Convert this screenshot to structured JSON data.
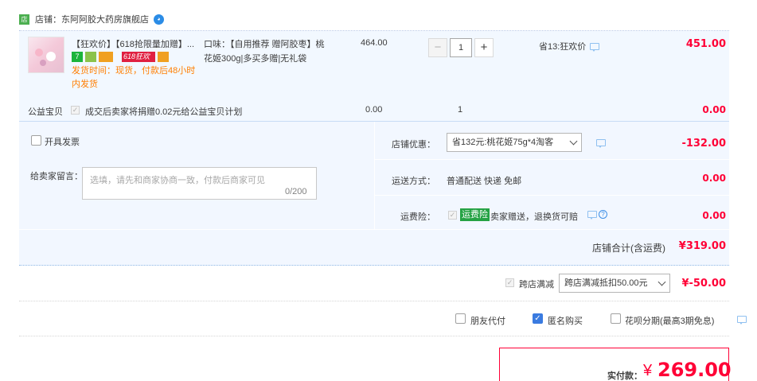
{
  "shop": {
    "icon": "店",
    "label": "店铺：东阿阿胶大药房旗舰店"
  },
  "item": {
    "title": "【狂欢价】【618抢限量加赠】...",
    "badge_618": "618狂欢",
    "badge_7": "7",
    "ship": "发货时间：现货，付款后48小时内发货",
    "sku": "口味：【自用推荐 赠阿胶枣】桃花姬300g|多买多赠|无礼袋",
    "price": "464.00",
    "qty": "1",
    "minus": "−",
    "plus": "+",
    "save": "省13:狂欢价",
    "total": "451.00"
  },
  "charity": {
    "label": "公益宝贝",
    "text": "成交后卖家将捐赠0.02元给公益宝贝计划",
    "price": "0.00",
    "qty": "1",
    "total": "0.00"
  },
  "invoice": {
    "label": "开具发票"
  },
  "message": {
    "label": "给卖家留言：",
    "placeholder": "选填，请先和商家协商一致，付款后商家可见",
    "count": "0/200"
  },
  "coupon": {
    "label": "店铺优惠：",
    "selected": "省132元:桃花姬75g*4淘客",
    "value": "-132.00"
  },
  "shipping": {
    "label": "运送方式：",
    "value": "普通配送 快递 免邮",
    "price": "0.00"
  },
  "insurance": {
    "label": "运费险：",
    "badge": "运费险",
    "text": "卖家赠送，退换货可赔",
    "price": "0.00"
  },
  "shop_total": {
    "label": "店铺合计(含运费)",
    "value": "¥319.00"
  },
  "cross_store": {
    "label": "跨店满减",
    "selected": "跨店满减抵扣50.00元",
    "value": "¥-50.00"
  },
  "options": {
    "friend_pay": "朋友代付",
    "anonymous": "匿名购买",
    "huabei": "花呗分期(最高3期免息)"
  },
  "payment": {
    "label": "实付款：",
    "currency": "¥",
    "value": "269.00"
  },
  "colors": {
    "accent": "#ff0036",
    "panel": "#f2f7ff",
    "link": "#3a7be0",
    "ship_text": "#ff7e00"
  }
}
